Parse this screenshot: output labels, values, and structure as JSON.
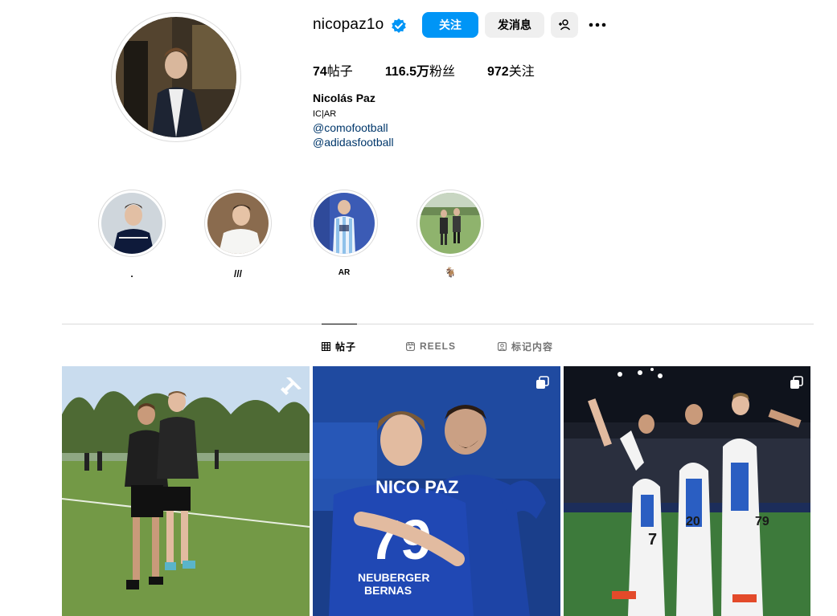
{
  "profile": {
    "username": "nicopaz1o",
    "follow_label": "关注",
    "message_label": "发消息",
    "stats": {
      "posts_count": "74",
      "posts_label": "帖子",
      "followers_count": "116.5万",
      "followers_label": "粉丝",
      "following_count": "972",
      "following_label": "关注"
    },
    "full_name": "Nicolás Paz",
    "bio_line": "IC|AR",
    "links": [
      "@comofootball",
      "@adidasfootball"
    ]
  },
  "highlights": [
    {
      "label": "."
    },
    {
      "label": "///"
    },
    {
      "label": "AR"
    },
    {
      "label": "🐐"
    }
  ],
  "tabs": [
    {
      "label": "帖子",
      "icon": "grid-icon",
      "active": true
    },
    {
      "label": "REELS",
      "icon": "reels-icon",
      "active": false
    },
    {
      "label": "标记内容",
      "icon": "tagged-icon",
      "active": false
    }
  ],
  "colors": {
    "accent": "#0095f6",
    "link": "#00376b",
    "verified": "#0095f6"
  }
}
